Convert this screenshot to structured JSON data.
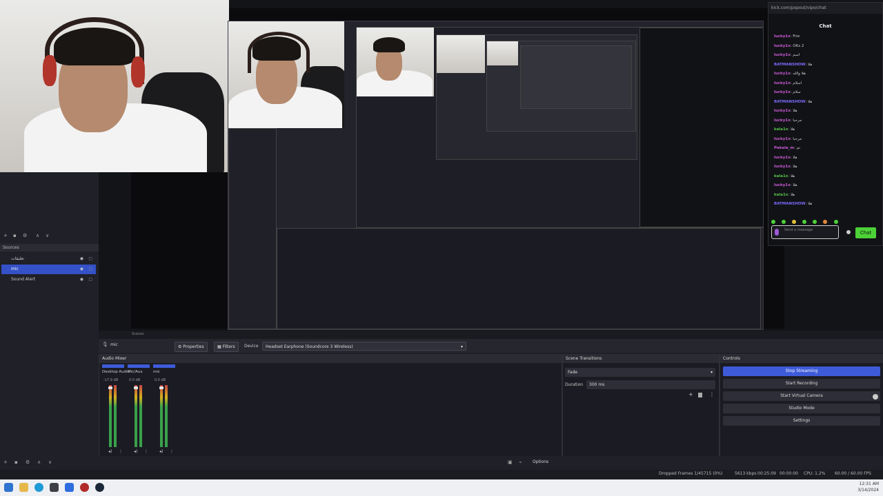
{
  "chat": {
    "url": "kick.com/popout/vipo/chat",
    "title": "Chat",
    "messages": [
      {
        "user": "lucky1x",
        "text": "Fire",
        "cls": "u"
      },
      {
        "user": "lucky1x",
        "text": "OKs 2",
        "cls": "u"
      },
      {
        "user": "lucky1x",
        "text": "اسم",
        "cls": "u"
      },
      {
        "user": "BATMANSHOW",
        "text": "هلا",
        "cls": "u2"
      },
      {
        "user": "lucky1x",
        "text": "هلا والله",
        "cls": "u"
      },
      {
        "user": "lucky1x",
        "text": "اسلام",
        "cls": "u"
      },
      {
        "user": "lucky1x",
        "text": "سلام",
        "cls": "u"
      },
      {
        "user": "BATMANSHOW",
        "text": "هلا",
        "cls": "u2"
      },
      {
        "user": "lucky1x",
        "text": "هلا",
        "cls": "u"
      },
      {
        "user": "lucky1x",
        "text": "مرحبا",
        "cls": "u"
      },
      {
        "user": "kala1x",
        "text": "هلا",
        "cls": "u3"
      },
      {
        "user": "lucky1x",
        "text": "مرحبا",
        "cls": "u"
      },
      {
        "user": "Pakala_m",
        "text": "تم",
        "cls": "u"
      },
      {
        "user": "lucky1x",
        "text": "هلا",
        "cls": "u"
      },
      {
        "user": "lucky1x",
        "text": "هلا",
        "cls": "u"
      },
      {
        "user": "kala1x",
        "text": "هلا",
        "cls": "u3"
      },
      {
        "user": "lucky1x",
        "text": "هلا",
        "cls": "u"
      },
      {
        "user": "kala1x",
        "text": "هلا",
        "cls": "u3"
      },
      {
        "user": "BATMANSHOW",
        "text": "هلا",
        "cls": "u2"
      }
    ],
    "input_placeholder": "Send a message",
    "send_label": "Chat"
  },
  "sources": {
    "title": "Sources",
    "items": [
      {
        "name": "تعليقات",
        "selected": false
      },
      {
        "name": "mic",
        "selected": true
      },
      {
        "name": "Sound Alert",
        "selected": false
      }
    ]
  },
  "context_bar": {
    "source_name": "mic",
    "properties_label": "Properties",
    "filters_label": "Filters",
    "device_label": "Device",
    "device_value": "Headset Earphone (Soundcore 3 Wireless)"
  },
  "audio_mixer": {
    "title": "Audio Mixer",
    "channels": [
      {
        "name": "Desktop Audio",
        "db": "-17.9 dB"
      },
      {
        "name": "Mic/Aux",
        "db": "0.0 dB"
      },
      {
        "name": "mic",
        "db": "0.0 dB"
      }
    ]
  },
  "transitions": {
    "title": "Scene Transitions",
    "type": "Fade",
    "duration_label": "Duration",
    "duration_value": "300 ms"
  },
  "controls": {
    "title": "Controls",
    "buttons": [
      {
        "label": "Stop Streaming",
        "active": true
      },
      {
        "label": "Start Recording",
        "active": false
      },
      {
        "label": "Start Virtual Camera",
        "active": false
      },
      {
        "label": "Studio Mode",
        "active": false
      },
      {
        "label": "Settings",
        "active": false
      }
    ]
  },
  "bottom": {
    "scenes_label": "Scenes",
    "options_label": "Options"
  },
  "status": {
    "dropped": "Dropped Frames 1/45715 (0%)",
    "bitrate": "5613 kbps",
    "time": "00:25:09",
    "rec_time": "00:00:00",
    "cpu": "CPU: 1.2%",
    "fps": "60.00 / 60.00 FPS"
  },
  "taskbar": {
    "time": "12:31 AM",
    "date": "3/14/2024"
  },
  "colors": {
    "accent": "#3d5bd9",
    "chat_send": "#4cd137",
    "meter_green": "#3aa14b"
  }
}
